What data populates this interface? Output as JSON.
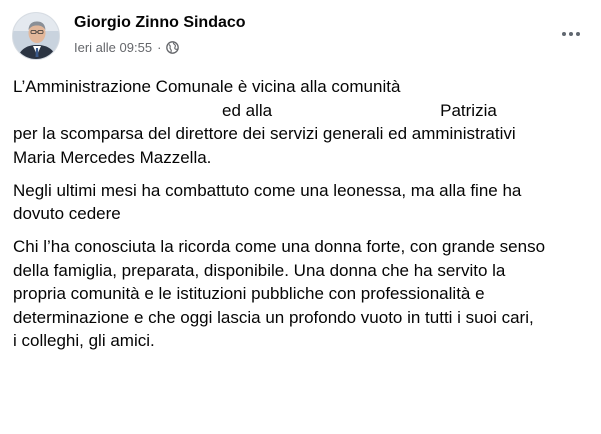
{
  "post": {
    "author": "Giorgio Zinno Sindaco",
    "timestamp": "Ieri alle 09:55",
    "separator": "·",
    "privacy_icon": "globe-icon",
    "menu_icon": "more-options-icon",
    "paragraphs": [
      [
        "L’Amministrazione Comunale è vicina alla comunità",
        "ed alla",
        "Patrizia",
        "per la scomparsa del direttore dei servizi generali ed amministrativi",
        "Maria Mercedes Mazzella."
      ],
      [
        "Negli ultimi mesi ha combattuto come una leonessa, ma alla fine ha",
        "dovuto cedere"
      ],
      [
        "Chi l’ha conosciuta la ricorda come una donna forte, con grande senso",
        "della famiglia, preparata, disponibile. Una donna che ha servito la",
        "propria comunità e le istituzioni pubbliche con professionalità e",
        "determinazione e che oggi lascia un profondo vuoto in tutti i suoi cari,",
        "i colleghi, gli amici."
      ]
    ]
  },
  "colors": {
    "text": "#050505",
    "secondary_text": "#65676b",
    "background": "#ffffff"
  }
}
